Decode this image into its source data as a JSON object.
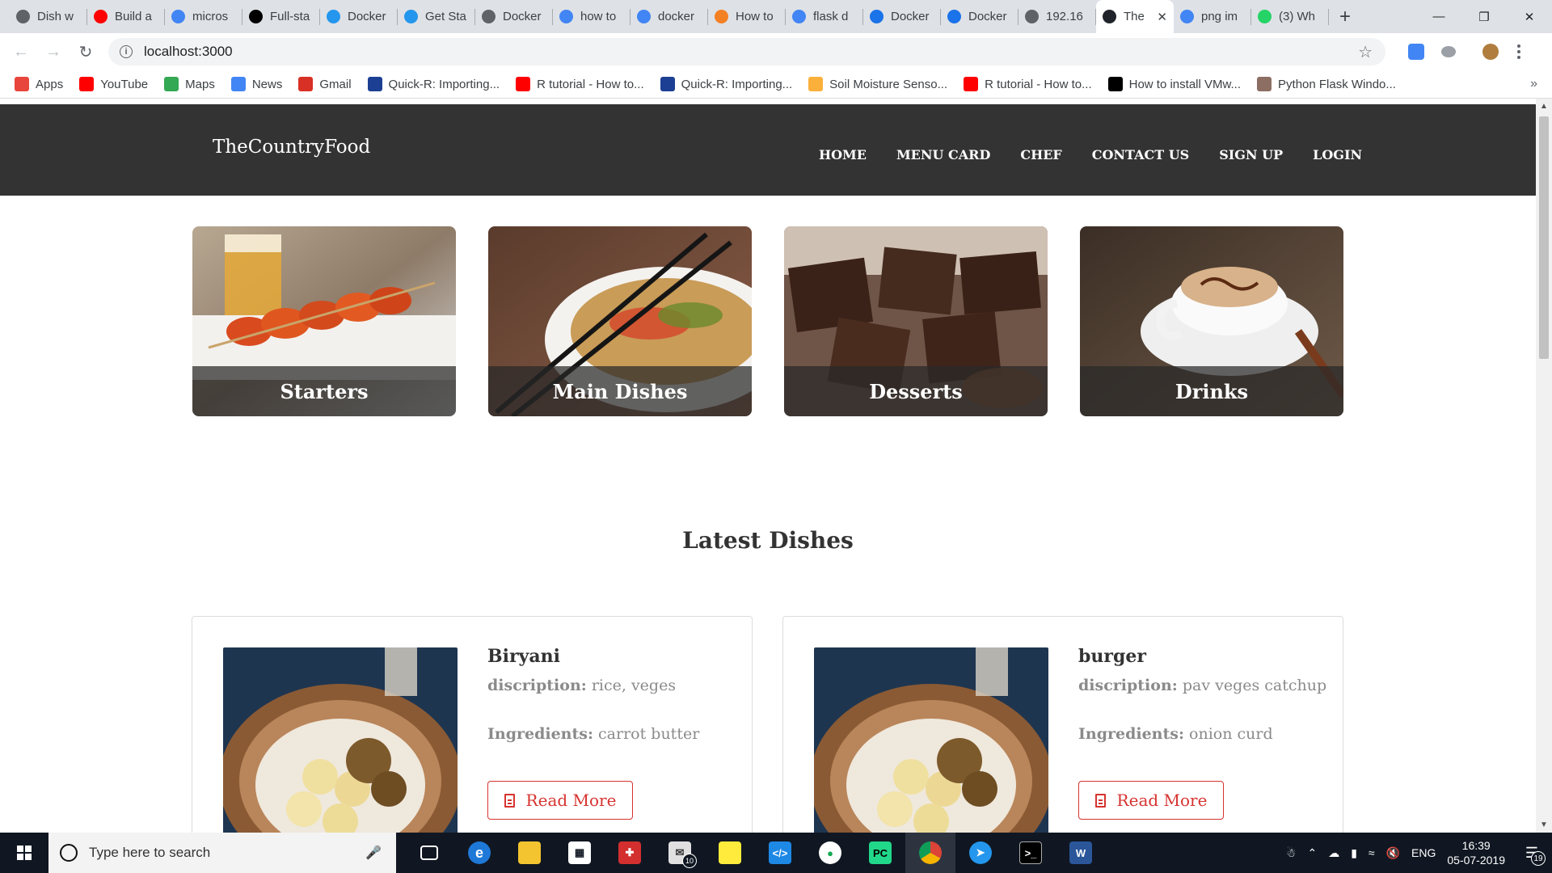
{
  "browser": {
    "tabs": [
      {
        "label": "Dish w",
        "icon": "globe-icon",
        "color": "#5f6368"
      },
      {
        "label": "Build a",
        "icon": "youtube-icon",
        "color": "#ff0000"
      },
      {
        "label": "micros",
        "icon": "google-icon",
        "color": "#4285f4"
      },
      {
        "label": "Full-sta",
        "icon": "medium-icon",
        "color": "#000000"
      },
      {
        "label": "Docker",
        "icon": "docker-icon",
        "color": "#2496ed"
      },
      {
        "label": "Get Sta",
        "icon": "docker-icon",
        "color": "#2496ed"
      },
      {
        "label": "Docker",
        "icon": "docker-icon",
        "color": "#5f6368"
      },
      {
        "label": "how to",
        "icon": "google-icon",
        "color": "#4285f4"
      },
      {
        "label": "docker",
        "icon": "google-icon",
        "color": "#4285f4"
      },
      {
        "label": "How to",
        "icon": "stackoverflow-icon",
        "color": "#f48024"
      },
      {
        "label": "flask d",
        "icon": "google-icon",
        "color": "#4285f4"
      },
      {
        "label": "Docker",
        "icon": "slash-icon",
        "color": "#1a73e8"
      },
      {
        "label": "Docker",
        "icon": "slash-icon",
        "color": "#1a73e8"
      },
      {
        "label": "192.16",
        "icon": "globe-icon",
        "color": "#5f6368"
      },
      {
        "label": "The",
        "icon": "react-icon",
        "color": "#20232a",
        "active": true
      },
      {
        "label": "png im",
        "icon": "google-icon",
        "color": "#4285f4"
      },
      {
        "label": "(3) Wh",
        "icon": "whatsapp-icon",
        "color": "#25d366"
      }
    ],
    "url": "localhost:3000",
    "bookmarks": [
      {
        "label": "Apps",
        "icon": "apps-grid-icon",
        "color": "#e8453c"
      },
      {
        "label": "YouTube",
        "icon": "youtube-icon",
        "color": "#ff0000"
      },
      {
        "label": "Maps",
        "icon": "maps-icon",
        "color": "#34a853"
      },
      {
        "label": "News",
        "icon": "news-icon",
        "color": "#4285f4"
      },
      {
        "label": "Gmail",
        "icon": "gmail-icon",
        "color": "#d93025"
      },
      {
        "label": "Quick-R: Importing...",
        "icon": "r-icon",
        "color": "#1c3f94"
      },
      {
        "label": "R tutorial - How to...",
        "icon": "youtube-icon",
        "color": "#ff0000"
      },
      {
        "label": "Quick-R: Importing...",
        "icon": "r-icon",
        "color": "#1c3f94"
      },
      {
        "label": "Soil Moisture Senso...",
        "icon": "instructables-icon",
        "color": "#fbb03b"
      },
      {
        "label": "R tutorial - How to...",
        "icon": "youtube-icon",
        "color": "#ff0000"
      },
      {
        "label": "How to install VMw...",
        "icon": "sj-icon",
        "color": "#000000"
      },
      {
        "label": "Python Flask Windo...",
        "icon": "avatar-icon",
        "color": "#8d6e63"
      }
    ]
  },
  "site": {
    "brand": "TheCountryFood",
    "nav": [
      "HOME",
      "MENU CARD",
      "CHEF",
      "CONTACT US",
      "SIGN UP",
      "LOGIN"
    ],
    "categories": [
      {
        "label": "Starters"
      },
      {
        "label": "Main Dishes"
      },
      {
        "label": "Desserts"
      },
      {
        "label": "Drinks"
      }
    ],
    "section_title": "Latest Dishes",
    "dishes": [
      {
        "name": "Biryani",
        "desc_label": "discription:",
        "desc": "rice, veges",
        "ing_label": "Ingredients:",
        "ing": "carrot butter",
        "button": "Read More"
      },
      {
        "name": "burger",
        "desc_label": "discription:",
        "desc": "pav veges catchup",
        "ing_label": "Ingredients:",
        "ing": "onion curd",
        "button": "Read More"
      }
    ]
  },
  "taskbar": {
    "search_placeholder": "Type here to search",
    "mail_badge": "10",
    "language": "ENG",
    "time": "16:39",
    "date": "05-07-2019",
    "notification_count": "19"
  }
}
